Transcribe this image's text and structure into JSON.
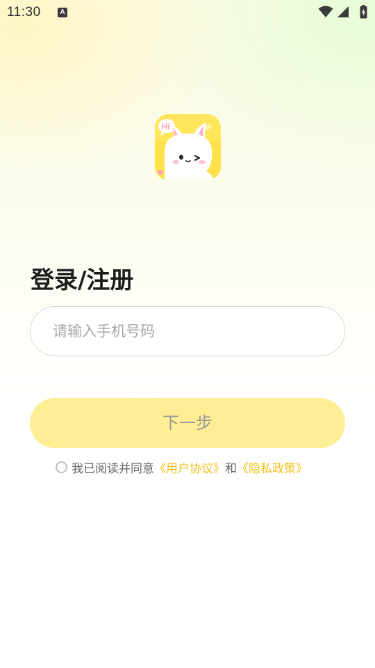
{
  "status_bar": {
    "time": "11:30",
    "notification_icon_letter": "A",
    "icons": [
      "wifi-icon",
      "signal-icon",
      "battery-charging-icon"
    ]
  },
  "app_logo": {
    "badge_text": "Hi",
    "colors": {
      "background": "#ffe14a",
      "heart": "#ffd84a",
      "cheek": "#ff9ec0"
    }
  },
  "login": {
    "title": "登录/注册",
    "phone_placeholder": "请输入手机号码",
    "phone_value": "",
    "next_label": "下一步"
  },
  "agreement": {
    "checked": false,
    "prefix": "我已阅读并同意",
    "user_agreement": "《用户协议》",
    "and": "和",
    "privacy_policy": "《隐私政策》"
  },
  "colors": {
    "accent": "#f2c21b",
    "button_disabled_bg": "#ffee94",
    "button_disabled_text": "#999999",
    "title": "#1c1c1c"
  }
}
